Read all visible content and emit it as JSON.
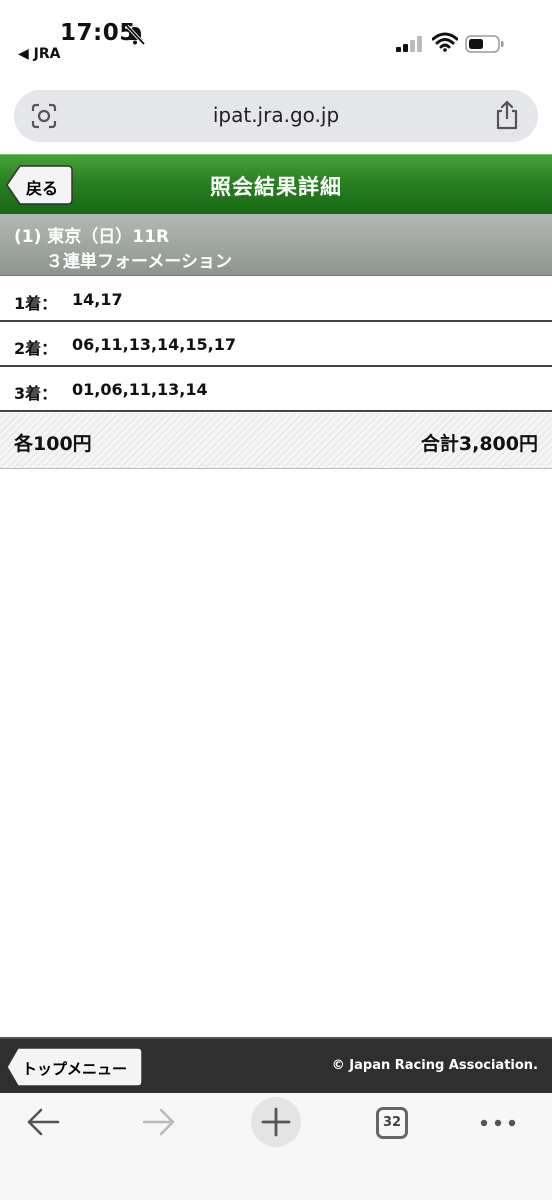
{
  "status_bar": {
    "time": "17:05",
    "back_app": "◀ JRA"
  },
  "browser": {
    "url": "ipat.jra.go.jp",
    "tab_count": "32"
  },
  "header": {
    "back_label": "戻る",
    "title": "照会結果詳細"
  },
  "race": {
    "line1": "(1) 東京（日）11R",
    "line2": "３連単フォーメーション"
  },
  "positions": [
    {
      "label": "1着：",
      "value": "14,17"
    },
    {
      "label": "2着：",
      "value": "06,11,13,14,15,17"
    },
    {
      "label": "3着：",
      "value": "01,06,11,13,14"
    }
  ],
  "summary": {
    "each": "各100円",
    "total": "合計3,800円"
  },
  "footer": {
    "top_menu": "トップメニュー",
    "copyright": "© Japan Racing Association."
  },
  "colors": {
    "header_green": "#2a7f22",
    "race_bar": "#9da29d",
    "footer": "#2f2f2f"
  }
}
